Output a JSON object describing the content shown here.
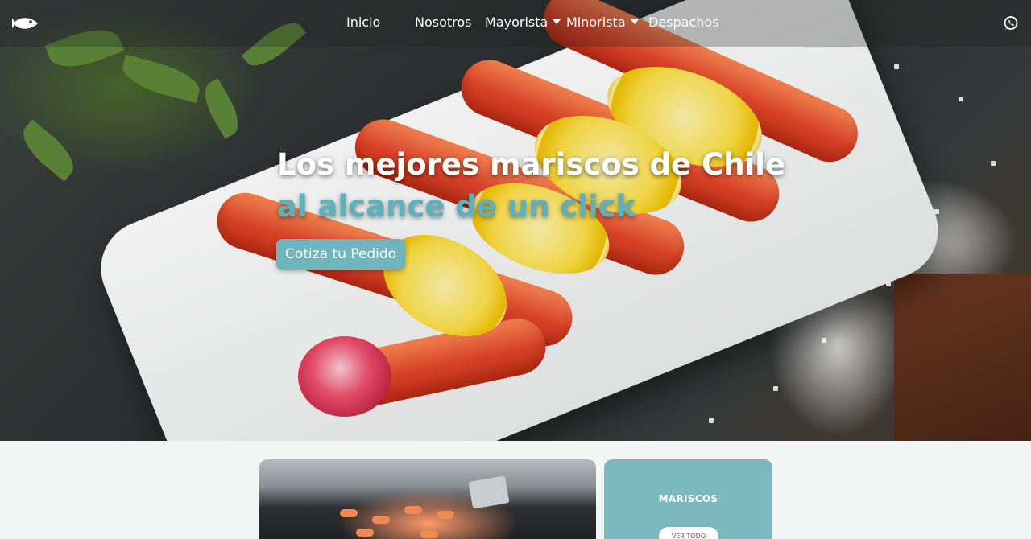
{
  "navbar": {
    "brand_icon": "fish-icon",
    "items": [
      {
        "label": "Inicio"
      },
      {
        "label": "Nosotros"
      },
      {
        "label": "Mayorista",
        "has_dropdown": true
      },
      {
        "label": "Minorista",
        "has_dropdown": true
      },
      {
        "label": "Despachos"
      }
    ],
    "social_icon": "whatsapp-icon"
  },
  "hero": {
    "headline_line1": "Los mejores mariscos de Chile",
    "headline_line2": "al alcance de un click",
    "cta_label": "Cotiza tu Pedido"
  },
  "category_card": {
    "title": "MARISCOS",
    "button_label": "VER TODO"
  },
  "colors": {
    "accent": "#6fb5be",
    "headline_accent": "#5fb0ba",
    "card_bg": "#7bb8bf",
    "page_bg": "#f4f6f6"
  }
}
